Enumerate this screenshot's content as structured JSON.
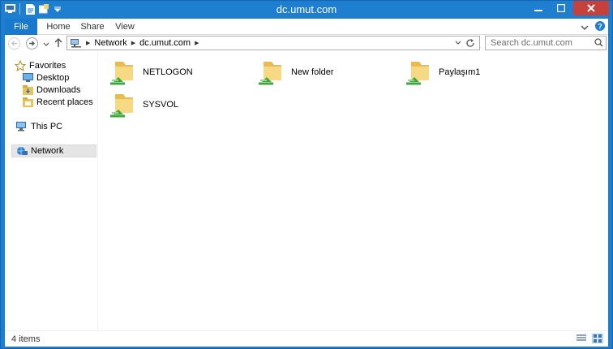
{
  "window": {
    "title": "dc.umut.com"
  },
  "ribbon": {
    "tabs": [
      "File",
      "Home",
      "Share",
      "View"
    ]
  },
  "nav": {
    "address": [
      "Network",
      "dc.umut.com"
    ],
    "search_placeholder": "Search dc.umut.com"
  },
  "sidebar": {
    "favorites": "Favorites",
    "desktop": "Desktop",
    "downloads": "Downloads",
    "recent": "Recent places",
    "thispc": "This PC",
    "network": "Network"
  },
  "folders": [
    "NETLOGON",
    "New folder",
    "Paylaşım1",
    "SYSVOL"
  ],
  "status": {
    "items": "4 items"
  },
  "colors": {
    "titlebar": "#1e7fd0",
    "file_tab": "#1979ca",
    "close": "#c7403a"
  }
}
